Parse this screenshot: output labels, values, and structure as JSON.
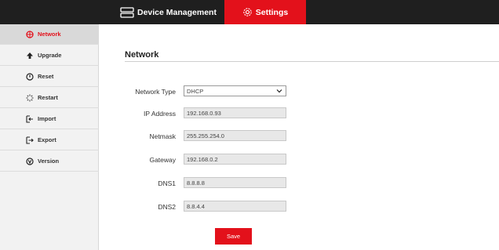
{
  "header": {
    "tabs": [
      {
        "label": "Device Management",
        "icon": "device-management-icon",
        "active": false
      },
      {
        "label": "Settings",
        "icon": "gear-icon",
        "active": true
      }
    ]
  },
  "sidebar": {
    "items": [
      {
        "label": "Network",
        "icon": "network-icon",
        "active": true
      },
      {
        "label": "Upgrade",
        "icon": "arrow-up-icon",
        "active": false
      },
      {
        "label": "Reset",
        "icon": "reset-icon",
        "active": false
      },
      {
        "label": "Restart",
        "icon": "spinner-icon",
        "active": false
      },
      {
        "label": "Import",
        "icon": "import-icon",
        "active": false
      },
      {
        "label": "Export",
        "icon": "export-icon",
        "active": false
      },
      {
        "label": "Version",
        "icon": "version-icon",
        "active": false
      }
    ]
  },
  "main": {
    "title": "Network",
    "form": {
      "network_type": {
        "label": "Network Type",
        "value": "DHCP"
      },
      "ip_address": {
        "label": "IP Address",
        "value": "192.168.0.93"
      },
      "netmask": {
        "label": "Netmask",
        "value": "255.255.254.0"
      },
      "gateway": {
        "label": "Gateway",
        "value": "192.168.0.2"
      },
      "dns1": {
        "label": "DNS1",
        "value": "8.8.8.8"
      },
      "dns2": {
        "label": "DNS2",
        "value": "8.8.4.4"
      }
    },
    "save_label": "Save"
  },
  "colors": {
    "accent": "#e3111b",
    "topbar": "#1f1f1f",
    "sidebar": "#f2f2f2"
  }
}
